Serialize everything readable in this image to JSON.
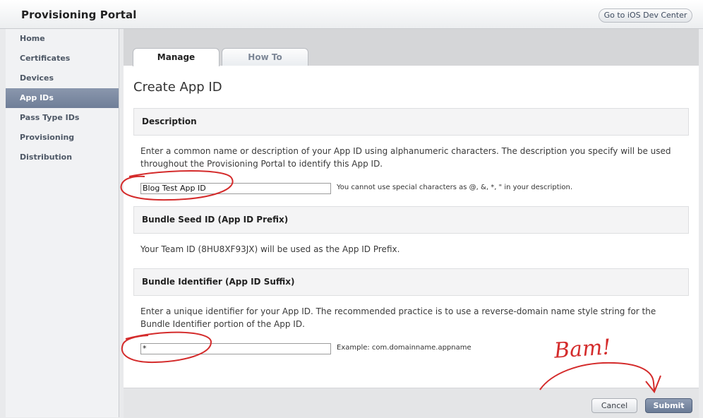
{
  "header": {
    "title": "Provisioning Portal",
    "dev_center_label": "Go to iOS Dev Center"
  },
  "sidebar": {
    "items": [
      {
        "label": "Home"
      },
      {
        "label": "Certificates"
      },
      {
        "label": "Devices"
      },
      {
        "label": "App IDs",
        "active": true
      },
      {
        "label": "Pass Type IDs"
      },
      {
        "label": "Provisioning"
      },
      {
        "label": "Distribution"
      }
    ]
  },
  "tabs": [
    {
      "label": "Manage",
      "active": true
    },
    {
      "label": "How To"
    }
  ],
  "page": {
    "title": "Create App ID"
  },
  "description": {
    "heading": "Description",
    "text": "Enter a common name or description of your App ID using alphanumeric characters. The description you specify will be used throughout the Provisioning Portal to identify this App ID.",
    "value": "Blog Test App ID",
    "hint": "You cannot use special characters as @, &, *, \" in your description."
  },
  "seed": {
    "heading": "Bundle Seed ID (App ID Prefix)",
    "text": "Your Team ID (8HU8XF93JX) will be used as the App ID Prefix."
  },
  "bundle": {
    "heading": "Bundle Identifier (App ID Suffix)",
    "text": "Enter a unique identifier for your App ID. The recommended practice is to use a reverse-domain name style string for the Bundle Identifier portion of the App ID.",
    "value": "*",
    "hint": "Example: com.domainname.appname"
  },
  "footer": {
    "cancel_label": "Cancel",
    "submit_label": "Submit"
  },
  "annotation": {
    "text": "Bam!",
    "color": "#d42b2b"
  }
}
